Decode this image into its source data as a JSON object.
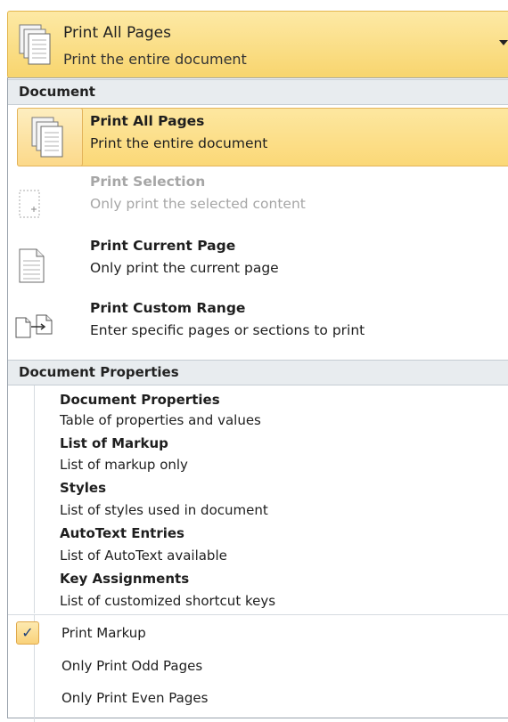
{
  "header": {
    "title": "Print All Pages",
    "subtitle": "Print the entire document",
    "icon": "print-all-pages-icon"
  },
  "document_section": {
    "heading": "Document",
    "items": [
      {
        "title": "Print All Pages",
        "desc": "Print the entire document",
        "icon": "print-all-pages-icon",
        "selected": true,
        "disabled": false
      },
      {
        "title": "Print Selection",
        "desc": "Only print the selected content",
        "icon": "print-selection-icon",
        "selected": false,
        "disabled": true
      },
      {
        "title": "Print Current Page",
        "desc": "Only print the current page",
        "icon": "print-current-page-icon",
        "selected": false,
        "disabled": false
      },
      {
        "title": "Print Custom Range",
        "desc": "Enter specific pages or sections to print",
        "icon": "print-custom-range-icon",
        "selected": false,
        "disabled": false
      }
    ]
  },
  "properties_section": {
    "heading": "Document Properties",
    "items": [
      {
        "title": "Document Properties",
        "desc": "Table of properties and values"
      },
      {
        "title": "List of Markup",
        "desc": "List of markup only"
      },
      {
        "title": "Styles",
        "desc": "List of styles used in document"
      },
      {
        "title": "AutoText Entries",
        "desc": "List of AutoText available"
      },
      {
        "title": "Key Assignments",
        "desc": "List of customized shortcut keys"
      }
    ]
  },
  "options": [
    {
      "label": "Print Markup",
      "checked": true,
      "check_glyph": "✓"
    },
    {
      "label": "Only Print Odd Pages",
      "checked": false
    },
    {
      "label": "Only Print Even Pages",
      "checked": false
    }
  ],
  "colors": {
    "highlight": "#fbd877",
    "highlight_border": "#e3b35a",
    "section_header_bg": "#e8ecef"
  }
}
